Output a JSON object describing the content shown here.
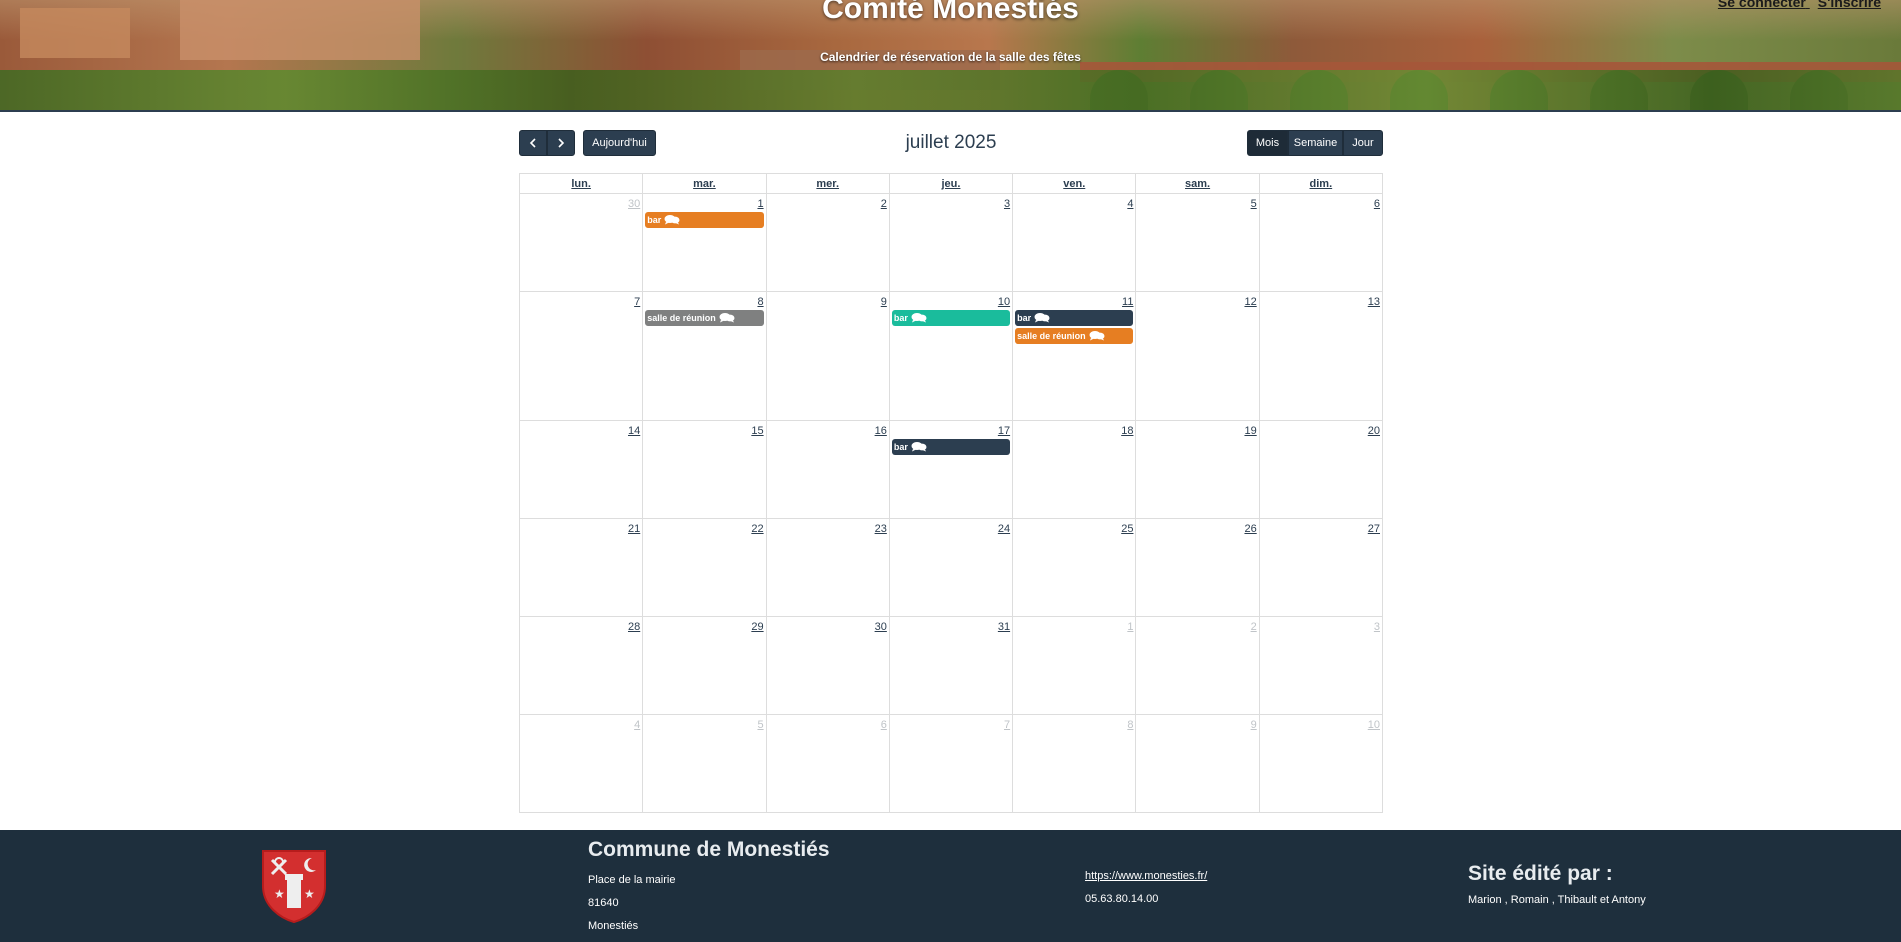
{
  "header": {
    "title": "Comité Monestiés",
    "subtitle": "Calendrier de réservation de la salle des fêtes",
    "login_label": "Se connecter",
    "register_label": "S'inscrire"
  },
  "calendar": {
    "title": "juillet 2025",
    "today_label": "Aujourd'hui",
    "prev_icon": "chevron-left",
    "next_icon": "chevron-right",
    "views": {
      "month": "Mois",
      "week": "Semaine",
      "day": "Jour"
    },
    "weekdays": [
      "lun.",
      "mar.",
      "mer.",
      "jeu.",
      "ven.",
      "sam.",
      "dim."
    ],
    "weeks": [
      {
        "days": [
          {
            "n": "30",
            "other": true,
            "events": []
          },
          {
            "n": "1",
            "events": [
              {
                "label": "bar",
                "color": "orange"
              }
            ]
          },
          {
            "n": "2",
            "events": []
          },
          {
            "n": "3",
            "events": []
          },
          {
            "n": "4",
            "events": []
          },
          {
            "n": "5",
            "events": []
          },
          {
            "n": "6",
            "events": []
          }
        ]
      },
      {
        "days": [
          {
            "n": "7",
            "events": []
          },
          {
            "n": "8",
            "events": [
              {
                "label": "salle de réunion",
                "color": "gray"
              }
            ]
          },
          {
            "n": "9",
            "events": []
          },
          {
            "n": "10",
            "events": [
              {
                "label": "bar",
                "color": "teal"
              }
            ]
          },
          {
            "n": "11",
            "events": [
              {
                "label": "bar",
                "color": "navy"
              },
              {
                "label": "salle de réunion",
                "color": "orange"
              }
            ]
          },
          {
            "n": "12",
            "events": []
          },
          {
            "n": "13",
            "events": []
          }
        ]
      },
      {
        "days": [
          {
            "n": "14",
            "events": []
          },
          {
            "n": "15",
            "events": []
          },
          {
            "n": "16",
            "events": []
          },
          {
            "n": "17",
            "events": [
              {
                "label": "bar",
                "color": "navy"
              }
            ]
          },
          {
            "n": "18",
            "events": []
          },
          {
            "n": "19",
            "events": []
          },
          {
            "n": "20",
            "events": []
          }
        ]
      },
      {
        "days": [
          {
            "n": "21",
            "events": []
          },
          {
            "n": "22",
            "events": []
          },
          {
            "n": "23",
            "events": []
          },
          {
            "n": "24",
            "events": []
          },
          {
            "n": "25",
            "events": []
          },
          {
            "n": "26",
            "events": []
          },
          {
            "n": "27",
            "events": []
          }
        ]
      },
      {
        "days": [
          {
            "n": "28",
            "events": []
          },
          {
            "n": "29",
            "events": []
          },
          {
            "n": "30",
            "events": []
          },
          {
            "n": "31",
            "events": []
          },
          {
            "n": "1",
            "other": true,
            "events": []
          },
          {
            "n": "2",
            "other": true,
            "events": []
          },
          {
            "n": "3",
            "other": true,
            "events": []
          }
        ]
      },
      {
        "days": [
          {
            "n": "4",
            "other": true,
            "events": []
          },
          {
            "n": "5",
            "other": true,
            "events": []
          },
          {
            "n": "6",
            "other": true,
            "events": []
          },
          {
            "n": "7",
            "other": true,
            "events": []
          },
          {
            "n": "8",
            "other": true,
            "events": []
          },
          {
            "n": "9",
            "other": true,
            "events": []
          },
          {
            "n": "10",
            "other": true,
            "events": []
          }
        ]
      }
    ],
    "event_icon": "chat-bubbles-icon",
    "colors": {
      "orange": "#e67e22",
      "gray": "#7f8080",
      "teal": "#1abc9c",
      "navy": "#2c3e50"
    }
  },
  "footer": {
    "commune_title": "Commune de Monestiés",
    "address_line1": "Place de la mairie",
    "address_line2": "81640",
    "address_line3": "Monestiés",
    "website": "https://www.monesties.fr/",
    "phone": "05.63.80.14.00",
    "edited_title": "Site édité par :",
    "authors": "Marion , Romain , Thibault et Antony",
    "logo": "commune-crest"
  }
}
